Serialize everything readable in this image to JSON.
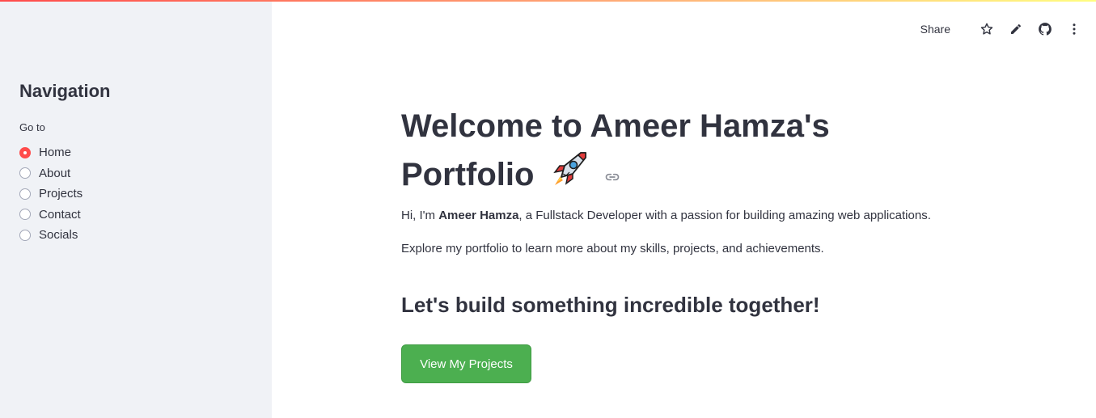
{
  "sidebar": {
    "title": "Navigation",
    "radio_label": "Go to",
    "options": [
      {
        "label": "Home",
        "selected": true
      },
      {
        "label": "About",
        "selected": false
      },
      {
        "label": "Projects",
        "selected": false
      },
      {
        "label": "Contact",
        "selected": false
      },
      {
        "label": "Socials",
        "selected": false
      }
    ]
  },
  "toolbar": {
    "share_label": "Share",
    "icons": [
      "star-icon",
      "pencil-icon",
      "github-icon",
      "more-vertical-icon"
    ]
  },
  "main": {
    "title_line1": "Welcome to Ameer Hamza's",
    "title_line2": "Portfolio",
    "title_emoji": "rocket-icon",
    "intro_prefix": "Hi, I'm ",
    "intro_name": "Ameer Hamza",
    "intro_suffix": ", a Fullstack Developer with a passion for building amazing web applications.",
    "explore_text": "Explore my portfolio to learn more about my skills, projects, and achievements.",
    "subheading": "Let's build something incredible together!",
    "button_label": "View My Projects"
  },
  "colors": {
    "accent": "#ff4b4b",
    "sidebar_bg": "#f0f2f6",
    "button_bg": "#4caf50",
    "text": "#31333f"
  }
}
